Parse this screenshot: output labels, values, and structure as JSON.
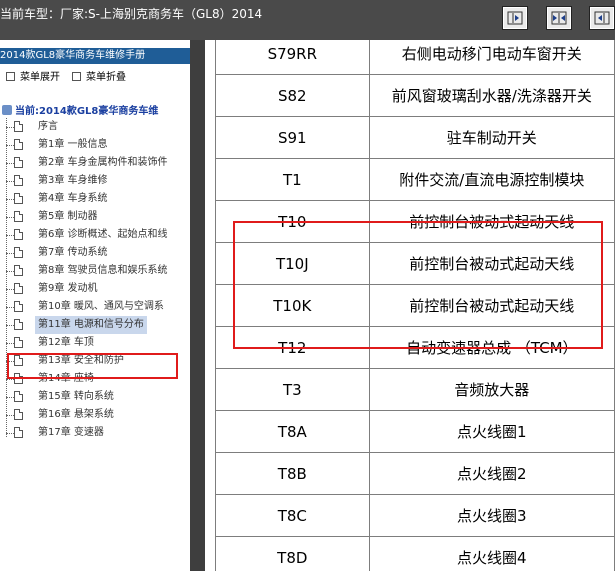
{
  "titlebar": {
    "title": "当前车型：厂家:S-上海别克商务车（GL8）2014"
  },
  "tree": {
    "manual_title": "2014款GL8豪华商务车维修手册",
    "expand_label": "菜单展开",
    "collapse_label": "菜单折叠",
    "current_label": "当前:2014款GL8豪华商务车维",
    "items": [
      {
        "label": "序言"
      },
      {
        "label": "第1章  一般信息"
      },
      {
        "label": "第2章  车身金属构件和装饰件"
      },
      {
        "label": "第3章  车身维修"
      },
      {
        "label": "第4章  车身系统"
      },
      {
        "label": "第5章  制动器"
      },
      {
        "label": "第6章  诊断概述、起始点和线"
      },
      {
        "label": "第7章  传动系统"
      },
      {
        "label": "第8章  驾驶员信息和娱乐系统"
      },
      {
        "label": "第9章  发动机"
      },
      {
        "label": "第10章  暖风、通风与空调系"
      },
      {
        "label": "第11章  电源和信号分布"
      },
      {
        "label": "第12章  车顶"
      },
      {
        "label": "第13章  安全和防护"
      },
      {
        "label": "第14章  座椅"
      },
      {
        "label": "第15章  转向系统"
      },
      {
        "label": "第16章  悬架系统"
      },
      {
        "label": "第17章  变速器"
      }
    ],
    "selected_index": 11
  },
  "table": {
    "rows": [
      {
        "code": "S79RR",
        "desc": "右侧电动移门电动车窗开关"
      },
      {
        "code": "S82",
        "desc": "前风窗玻璃刮水器/洗涤器开关"
      },
      {
        "code": "S91",
        "desc": "驻车制动开关"
      },
      {
        "code": "T1",
        "desc": "附件交流/直流电源控制模块"
      },
      {
        "code": "T10",
        "desc": "前控制台被动式起动天线"
      },
      {
        "code": "T10J",
        "desc": "前控制台被动式起动天线"
      },
      {
        "code": "T10K",
        "desc": "前控制台被动式起动天线"
      },
      {
        "code": "T12",
        "desc": "自动变速器总成 （TCM）"
      },
      {
        "code": "T3",
        "desc": "音频放大器"
      },
      {
        "code": "T8A",
        "desc": "点火线圈1"
      },
      {
        "code": "T8B",
        "desc": "点火线圈2"
      },
      {
        "code": "T8C",
        "desc": "点火线圈3"
      },
      {
        "code": "T8D",
        "desc": "点火线圈4"
      }
    ]
  },
  "colors": {
    "titlebar_bg": "#4a4a4a",
    "manual_header_bg": "#1f5d97",
    "highlight_border": "#e01b1b",
    "splitter": "#3e3e3e"
  },
  "icons": {
    "toolbar": [
      "collapse-left-icon",
      "center-split-icon",
      "expand-right-icon"
    ],
    "tree_node": "document-icon",
    "tree_root": "book-icon"
  }
}
